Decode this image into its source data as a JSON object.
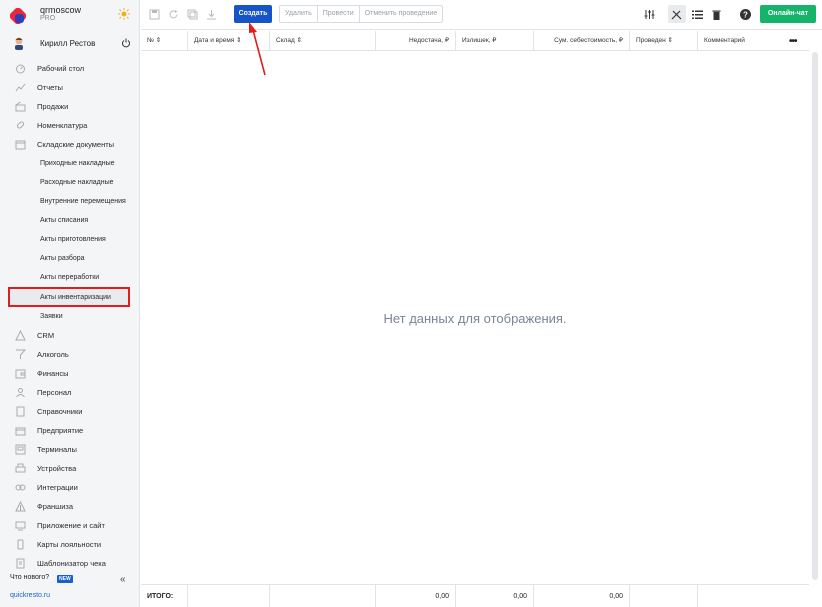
{
  "brand": {
    "name": "qrmoscow",
    "plan": "PRO"
  },
  "user": {
    "name": "Кирилл Рестов"
  },
  "menu": [
    {
      "label": "Рабочий стол",
      "icon": "dashboard-icon"
    },
    {
      "label": "Отчеты",
      "icon": "reports-icon"
    },
    {
      "label": "Продажи",
      "icon": "sales-icon"
    },
    {
      "label": "Номенклатура",
      "icon": "nomenclature-icon"
    },
    {
      "label": "Складские документы",
      "icon": "warehouse-docs-icon"
    }
  ],
  "submenu": [
    "Приходные накладные",
    "Расходные накладные",
    "Внутренние перемещения",
    "Акты списания",
    "Акты приготовления",
    "Акты разбора",
    "Акты переработки",
    "Акты инвентаризации",
    "Заявки"
  ],
  "menu_bottom": [
    {
      "label": "CRM",
      "icon": "crm-icon"
    },
    {
      "label": "Алкоголь",
      "icon": "alcohol-icon"
    },
    {
      "label": "Финансы",
      "icon": "finance-icon"
    },
    {
      "label": "Персонал",
      "icon": "staff-icon"
    },
    {
      "label": "Справочники",
      "icon": "directories-icon"
    },
    {
      "label": "Предприятие",
      "icon": "enterprise-icon"
    },
    {
      "label": "Терминалы",
      "icon": "terminals-icon"
    },
    {
      "label": "Устройства",
      "icon": "devices-icon"
    },
    {
      "label": "Интеграции",
      "icon": "integrations-icon"
    },
    {
      "label": "Франшиза",
      "icon": "franchise-icon"
    },
    {
      "label": "Приложение и сайт",
      "icon": "app-site-icon"
    },
    {
      "label": "Карты лояльности",
      "icon": "loyalty-cards-icon"
    },
    {
      "label": "Шаблонизатор чека",
      "icon": "receipt-template-icon"
    }
  ],
  "footer": {
    "whats_new": "Что нового?",
    "new_badge": "NEW",
    "site": "quickresto.ru",
    "collapse": "«"
  },
  "toolbar": {
    "create": "Создать",
    "delete": "Удалить",
    "post": "Провести",
    "unpost": "Отменить проведение",
    "online_chat": "Онлайн-чат"
  },
  "table": {
    "columns": [
      "№ ⇕",
      "Дата и время ⇕",
      "Склад ⇕",
      "Недостача, ₽",
      "Излишек, ₽",
      "Сум. себестоимость, ₽",
      "Проведен ⇕",
      "Комментарий"
    ],
    "empty_message": "Нет данных для отображения.",
    "footer": {
      "label": "ИТОГО:",
      "shortage": "0,00",
      "surplus": "0,00",
      "cost": "0,00"
    },
    "more": "•••"
  },
  "colors": {
    "primary": "#1654c9",
    "chat": "#16b36b",
    "highlight": "#e01e1e"
  }
}
